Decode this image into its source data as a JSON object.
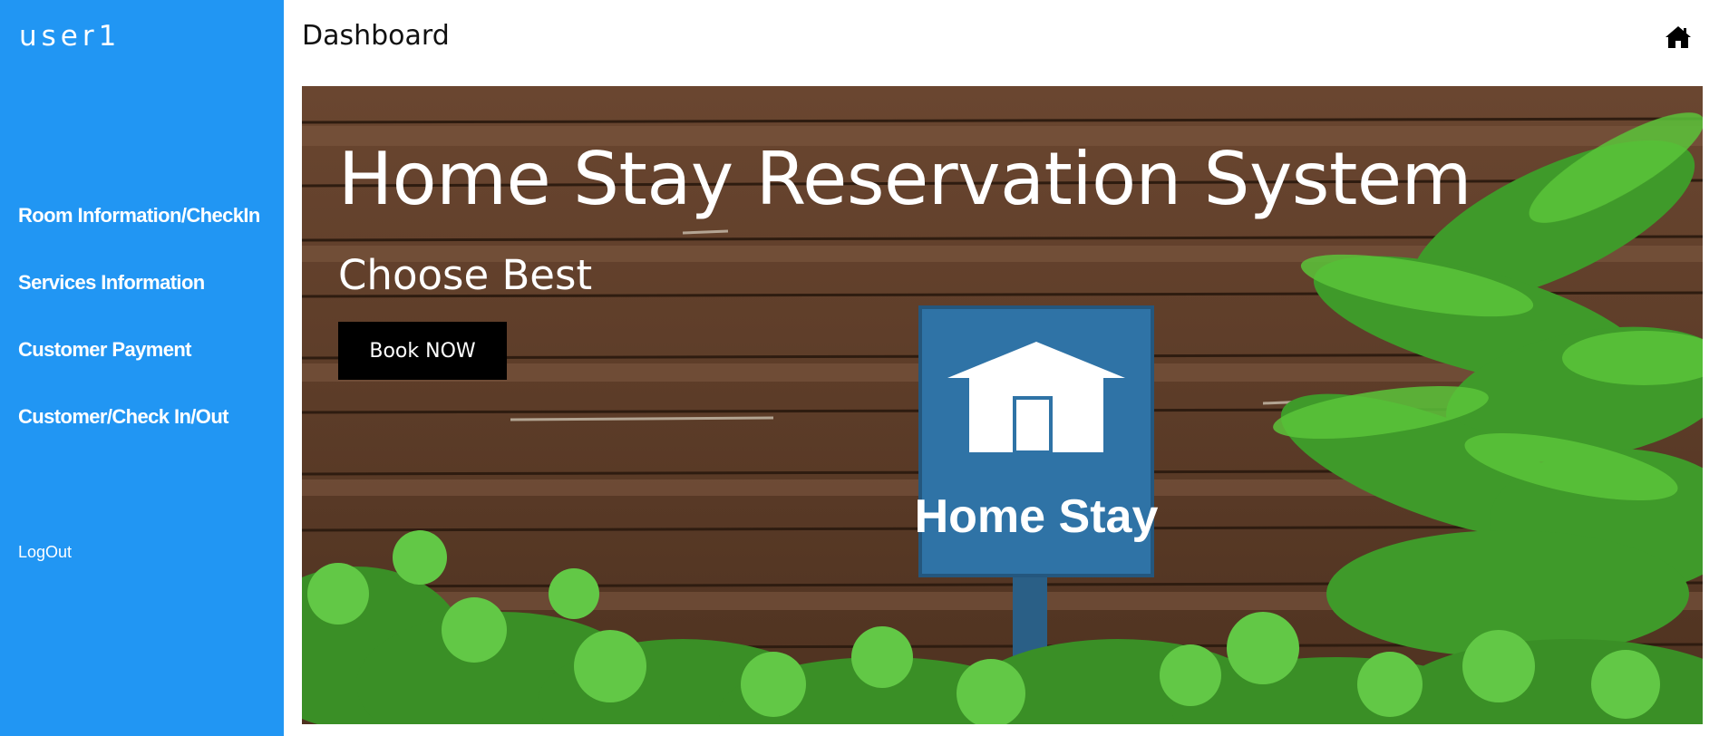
{
  "sidebar": {
    "brand": "user1",
    "items": [
      {
        "label": "Room Information/CheckIn"
      },
      {
        "label": "Services Information"
      },
      {
        "label": "Customer Payment"
      },
      {
        "label": "Customer/Check In/Out"
      }
    ],
    "logout_label": "LogOut"
  },
  "header": {
    "title": "Dashboard",
    "home_icon": "home-icon"
  },
  "hero": {
    "title": "Home Stay Reservation System",
    "subtitle": "Choose Best",
    "button_label": "Book NOW",
    "sign_text": "Home Stay"
  },
  "colors": {
    "sidebar_bg": "#2196f3",
    "button_bg": "#000000",
    "sign_blue": "#2f73a6"
  }
}
